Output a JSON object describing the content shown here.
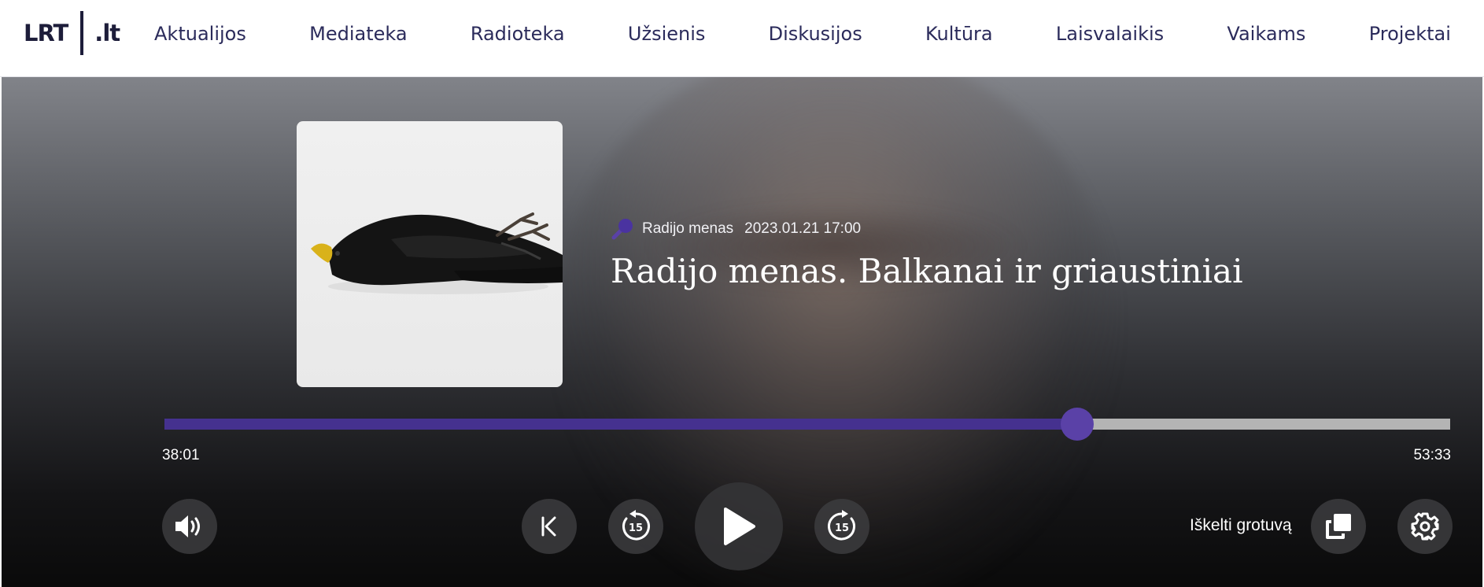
{
  "brand": {
    "logo_left": "LRT",
    "logo_right": ".lt"
  },
  "nav": {
    "items": [
      {
        "label": "Aktualijos"
      },
      {
        "label": "Mediateka"
      },
      {
        "label": "Radioteka"
      },
      {
        "label": "Užsienis"
      },
      {
        "label": "Diskusijos"
      },
      {
        "label": "Kultūra"
      },
      {
        "label": "Laisvalaikis"
      },
      {
        "label": "Vaikams"
      },
      {
        "label": "Projektai"
      }
    ]
  },
  "player": {
    "category": "Radijo menas",
    "date": "2023.01.21 17:00",
    "title": "Radijo menas. Balkanai ir griaustiniai",
    "current_time": "38:01",
    "total_time": "53:33",
    "progress_fraction": 0.7099,
    "rewind_seconds": "15",
    "forward_seconds": "15",
    "popout_label": "Iškelti grotuvą",
    "accent_color": "#45318f",
    "thumb_color": "#5a41a7",
    "icons": {
      "volume": "volume-icon",
      "previous": "skip-previous-icon",
      "rewind": "rewind-15-icon",
      "play": "play-icon",
      "forward": "forward-15-icon",
      "popout": "popout-icon",
      "settings": "gear-icon",
      "category": "microphone-icon"
    }
  }
}
